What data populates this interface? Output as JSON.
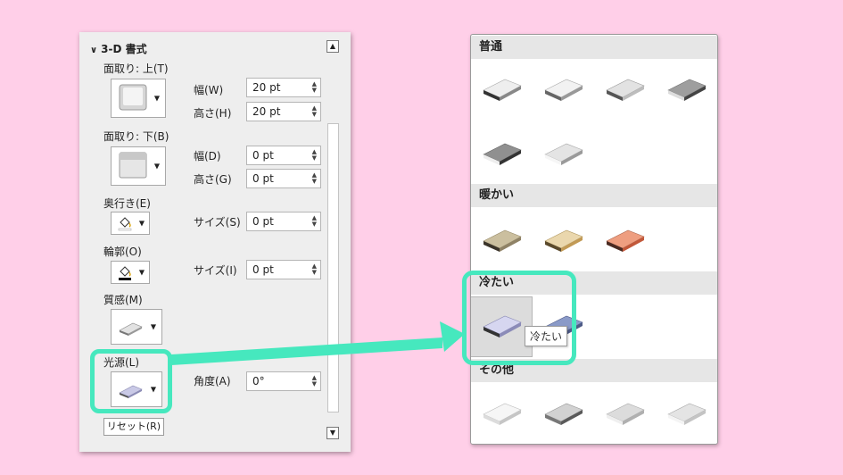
{
  "pane": {
    "title": "3-D 書式",
    "bevel_top": {
      "label": "面取り: 上(T)",
      "width_label": "幅(W)",
      "width_value": "20 pt",
      "height_label": "高さ(H)",
      "height_value": "20 pt"
    },
    "bevel_bottom": {
      "label": "面取り: 下(B)",
      "width_label": "幅(D)",
      "width_value": "0 pt",
      "height_label": "高さ(G)",
      "height_value": "0 pt"
    },
    "depth": {
      "label": "奥行き(E)",
      "size_label": "サイズ(S)",
      "size_value": "0 pt"
    },
    "contour": {
      "label": "輪郭(O)",
      "size_label": "サイズ(I)",
      "size_value": "0 pt"
    },
    "material": {
      "label": "質感(M)"
    },
    "lighting": {
      "label": "光源(L)",
      "angle_label": "角度(A)",
      "angle_value": "0°"
    },
    "reset_label": "リセット(R)"
  },
  "gallery": {
    "sections": [
      "普通",
      "暖かい",
      "冷たい",
      "その他"
    ],
    "tooltip": "冷たい"
  },
  "colors": {
    "highlight": "#46E8BE",
    "background": "#FFCFE8"
  }
}
